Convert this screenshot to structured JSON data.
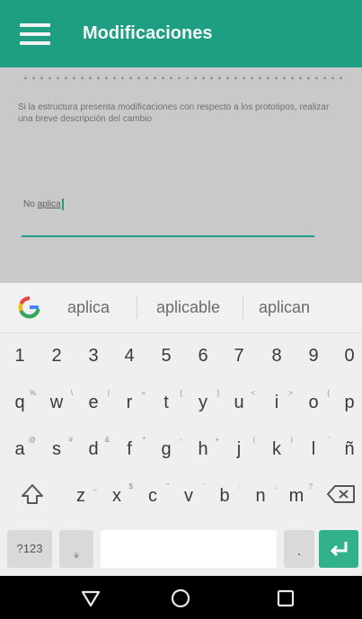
{
  "app_bar": {
    "title": "Modificaciones",
    "menu_icon": "hamburger-menu-icon"
  },
  "content": {
    "description": "Si la estructura presenta modificaciones con respecto a los prototipos, realizar una breve descripción del cambio",
    "input_value_prefix": "No ",
    "input_value_selected": "aplica"
  },
  "suggestions": [
    "aplica",
    "aplicable",
    "aplican"
  ],
  "keyboard": {
    "number_row": [
      "1",
      "2",
      "3",
      "4",
      "5",
      "6",
      "7",
      "8",
      "9",
      "0"
    ],
    "row1": [
      "q",
      "w",
      "e",
      "r",
      "t",
      "y",
      "u",
      "i",
      "o",
      "p"
    ],
    "row2": [
      "a",
      "s",
      "d",
      "f",
      "g",
      "h",
      "j",
      "k",
      "l",
      "ñ"
    ],
    "row3": [
      "z",
      "x",
      "c",
      "v",
      "b",
      "n",
      "m"
    ],
    "symbols_label": "?123",
    "comma_label": ",",
    "period_label": "."
  },
  "colors": {
    "accent": "#1e9e82",
    "enter_key": "#31b28b",
    "google_blue": "#4285f4"
  },
  "nav": {
    "back_icon": "back-triangle-icon",
    "home_icon": "home-circle-icon",
    "recents_icon": "recents-square-icon"
  }
}
